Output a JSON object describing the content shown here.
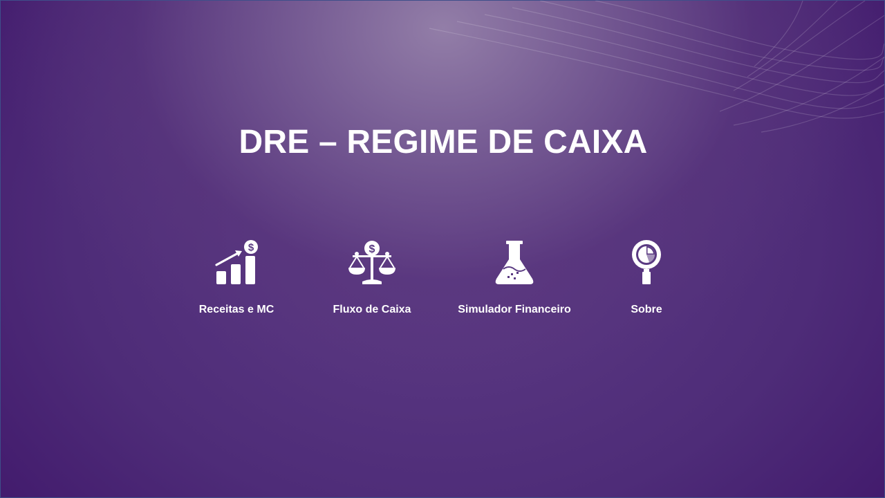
{
  "slide": {
    "title": "DRE – REGIME DE CAIXA",
    "background_colors": [
      "#3f166a",
      "#5e3c85",
      "#8a74a0"
    ],
    "text_color": "#ffffff"
  },
  "nav": {
    "items": [
      {
        "label": "Receitas e MC",
        "icon": "revenue-growth-chart-icon"
      },
      {
        "label": "Fluxo de Caixa",
        "icon": "balance-scale-dollar-icon"
      },
      {
        "label": "Simulador Financeiro",
        "icon": "lab-flask-icon"
      },
      {
        "label": "Sobre",
        "icon": "magnifier-pie-chart-icon"
      }
    ]
  }
}
